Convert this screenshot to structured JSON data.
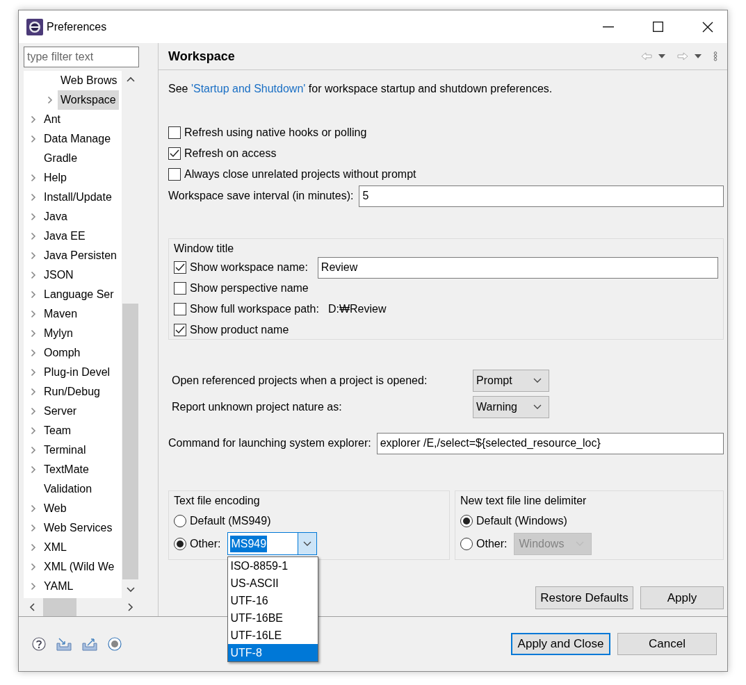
{
  "window": {
    "title": "Preferences"
  },
  "filter": {
    "placeholder": "type filter text"
  },
  "tree": {
    "partial_branch": [
      {
        "label": "Web Brows",
        "expandable": false,
        "selected": false
      },
      {
        "label": "Workspace",
        "expandable": true,
        "selected": true
      }
    ],
    "items": [
      {
        "label": "Ant",
        "expandable": true,
        "selected": false
      },
      {
        "label": "Data Manage",
        "expandable": true,
        "selected": false
      },
      {
        "label": "Gradle",
        "expandable": false,
        "selected": false
      },
      {
        "label": "Help",
        "expandable": true,
        "selected": false
      },
      {
        "label": "Install/Update",
        "expandable": true,
        "selected": false
      },
      {
        "label": "Java",
        "expandable": true,
        "selected": false
      },
      {
        "label": "Java EE",
        "expandable": true,
        "selected": false
      },
      {
        "label": "Java Persisten",
        "expandable": true,
        "selected": false
      },
      {
        "label": "JSON",
        "expandable": true,
        "selected": false
      },
      {
        "label": "Language Ser",
        "expandable": true,
        "selected": false
      },
      {
        "label": "Maven",
        "expandable": true,
        "selected": false
      },
      {
        "label": "Mylyn",
        "expandable": true,
        "selected": false
      },
      {
        "label": "Oomph",
        "expandable": true,
        "selected": false
      },
      {
        "label": "Plug-in Devel",
        "expandable": true,
        "selected": false
      },
      {
        "label": "Run/Debug",
        "expandable": true,
        "selected": false
      },
      {
        "label": "Server",
        "expandable": true,
        "selected": false
      },
      {
        "label": "Team",
        "expandable": true,
        "selected": false
      },
      {
        "label": "Terminal",
        "expandable": true,
        "selected": false
      },
      {
        "label": "TextMate",
        "expandable": true,
        "selected": false
      },
      {
        "label": "Validation",
        "expandable": false,
        "selected": false
      },
      {
        "label": "Web",
        "expandable": true,
        "selected": false
      },
      {
        "label": "Web Services",
        "expandable": true,
        "selected": false
      },
      {
        "label": "XML",
        "expandable": true,
        "selected": false
      },
      {
        "label": "XML (Wild We",
        "expandable": true,
        "selected": false
      },
      {
        "label": "YAML",
        "expandable": true,
        "selected": false
      }
    ]
  },
  "page": {
    "title": "Workspace",
    "intro": {
      "before": "See ",
      "link": "'Startup and Shutdown'",
      "after": " for workspace startup and shutdown preferences."
    },
    "checkboxes": [
      {
        "label": "Refresh using native hooks or polling",
        "checked": false
      },
      {
        "label": "Refresh on access",
        "checked": true
      },
      {
        "label": "Always close unrelated projects without prompt",
        "checked": false
      }
    ],
    "save_interval": {
      "label": "Workspace save interval (in minutes):",
      "value": "5"
    },
    "window_title": {
      "legend": "Window title",
      "rows": [
        {
          "kind": "field",
          "label": "Show workspace name:",
          "checked": true,
          "value": "Review"
        },
        {
          "kind": "plain",
          "label": "Show perspective name",
          "checked": false
        },
        {
          "kind": "path",
          "label": "Show full workspace path:",
          "checked": false,
          "path": "D:₩Review"
        },
        {
          "kind": "plain",
          "label": "Show product name",
          "checked": true
        }
      ]
    },
    "combos": [
      {
        "label": "Open referenced projects when a project is opened:",
        "value": "Prompt"
      },
      {
        "label": "Report unknown project nature as:",
        "value": "Warning"
      }
    ],
    "explorer": {
      "label": "Command for launching system explorer:",
      "value": "explorer /E,/select=${selected_resource_loc}"
    },
    "encoding": {
      "legend": "Text file encoding",
      "options": [
        {
          "label": "Default (MS949)",
          "selected": false
        },
        {
          "label": "Other:",
          "selected": true
        }
      ],
      "value": "MS949",
      "dropdown": [
        {
          "label": "ISO-8859-1",
          "selected": false
        },
        {
          "label": "US-ASCII",
          "selected": false
        },
        {
          "label": "UTF-16",
          "selected": false
        },
        {
          "label": "UTF-16BE",
          "selected": false
        },
        {
          "label": "UTF-16LE",
          "selected": false
        },
        {
          "label": "UTF-8",
          "selected": true
        }
      ]
    },
    "delimiter": {
      "legend": "New text file line delimiter",
      "options": [
        {
          "label": "Default (Windows)",
          "selected": true
        },
        {
          "label": "Other:",
          "selected": false
        }
      ],
      "value": "Windows",
      "disabled": true
    },
    "buttons": [
      "Restore Defaults",
      "Apply"
    ]
  },
  "footer_buttons": [
    {
      "label": "Apply and Close",
      "default": true
    },
    {
      "label": "Cancel",
      "default": false
    }
  ]
}
